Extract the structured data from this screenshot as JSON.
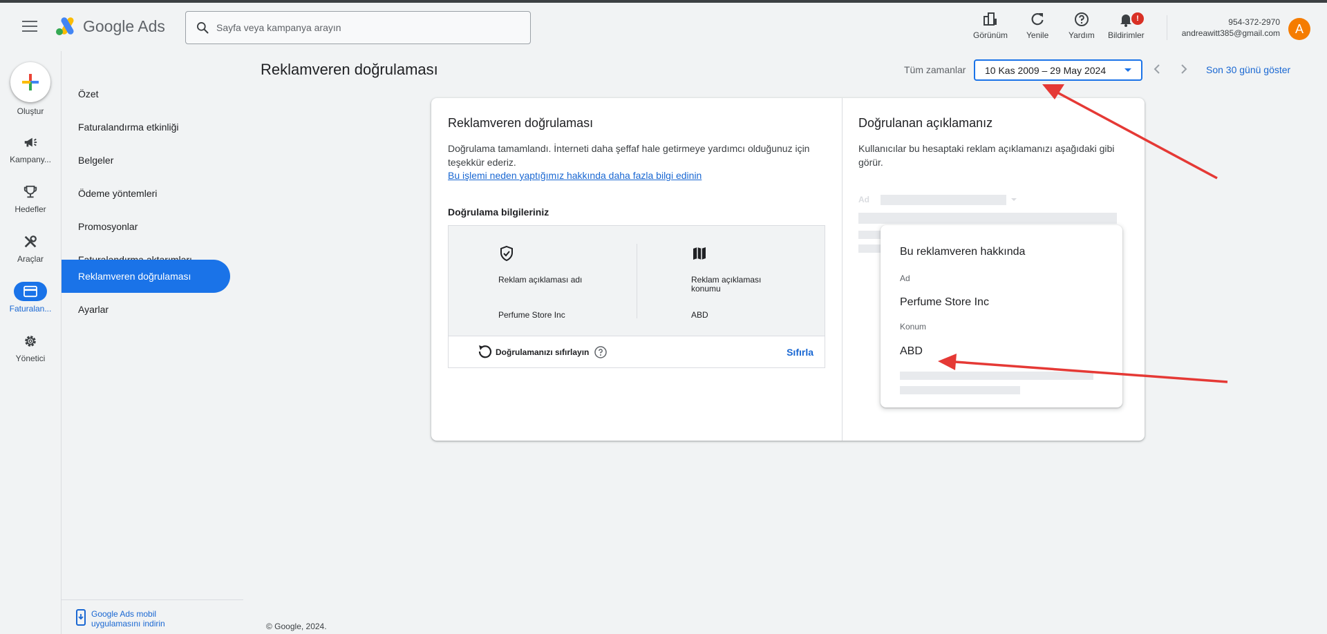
{
  "header": {
    "logo_text": "Google Ads",
    "search_placeholder": "Sayfa veya kampanya arayın",
    "buttons": [
      {
        "label": "Görünüm",
        "icon": "view-icon"
      },
      {
        "label": "Yenile",
        "icon": "refresh-icon"
      },
      {
        "label": "Yardım",
        "icon": "help-icon"
      },
      {
        "label": "Bildirimler",
        "icon": "bell-icon",
        "badge": "!"
      }
    ],
    "account_id": "954-372-2970",
    "account_email": "andreawitt385@gmail.com",
    "avatar_letter": "A"
  },
  "rail": {
    "create_label": "Oluştur",
    "items": [
      {
        "label": "Kampany...",
        "icon": "megaphone-icon"
      },
      {
        "label": "Hedefler",
        "icon": "trophy-icon"
      },
      {
        "label": "Araçlar",
        "icon": "tools-icon"
      },
      {
        "label": "Faturalan...",
        "icon": "credit-card-icon",
        "active": true
      },
      {
        "label": "Yönetici",
        "icon": "gear-icon"
      }
    ]
  },
  "subnav": {
    "items": [
      {
        "label": "Özet"
      },
      {
        "label": "Faturalandırma etkinliği"
      },
      {
        "label": "Belgeler"
      },
      {
        "label": "Ödeme yöntemleri"
      },
      {
        "label": "Promosyonlar"
      },
      {
        "label": "Faturalandırma aktarımları"
      },
      {
        "label": "Reklamveren doğrulaması",
        "active": true
      },
      {
        "label": "Ayarlar"
      }
    ],
    "mobile_link": "Google Ads mobil uygulamasını indirin"
  },
  "page": {
    "title": "Reklamveren doğrulaması",
    "date_label": "Tüm zamanlar",
    "date_range": "10 Kas 2009 – 29 May 2024",
    "show_30": "Son 30 günü göster",
    "copyright": "© Google, 2024."
  },
  "left_panel": {
    "title": "Reklamveren doğrulaması",
    "description": "Doğrulama tamamlandı. İnterneti daha şeffaf hale getirmeye yardımcı olduğunuz için teşekkür ederiz.",
    "link": "Bu işlemi neden yaptığımız hakkında daha fazla bilgi edinin",
    "info_title": "Doğrulama bilgileriniz",
    "name_label": "Reklam açıklaması adı",
    "name_value": "Perfume Store Inc",
    "location_label": "Reklam açıklaması konumu",
    "location_value": "ABD",
    "reset_text": "Doğrulamanızı sıfırlayın",
    "reset_button": "Sıfırla"
  },
  "right_panel": {
    "title": "Doğrulanan açıklamanız",
    "description": "Kullanıcılar bu hesaptaki reklam açıklamanızı aşağıdaki gibi görür.",
    "placeholder_ad": "Ad",
    "about_title": "Bu reklamveren hakkında",
    "name_label": "Ad",
    "name_value": "Perfume Store Inc",
    "location_label": "Konum",
    "location_value": "ABD"
  },
  "colors": {
    "accent": "#1a73e8",
    "annotation_arrow": "#e53935",
    "avatar": "#f57c00"
  }
}
